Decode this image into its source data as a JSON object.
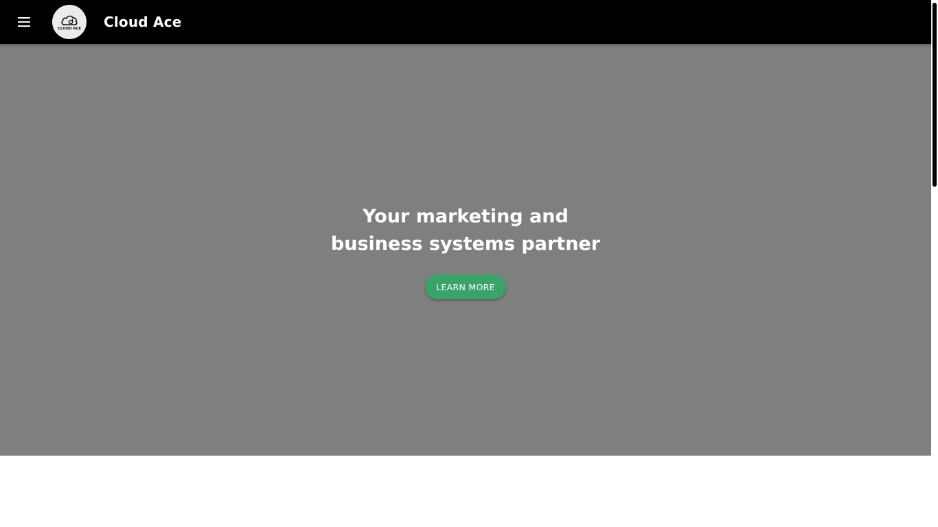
{
  "header": {
    "menu_icon": "hamburger-menu-icon",
    "logo_text": "CLOUD ACE",
    "logo_icon": "cloud-icon",
    "title": "Cloud Ace",
    "background": "#000000"
  },
  "hero": {
    "heading_line1": "Your marketing and",
    "heading_line2": "business systems partner",
    "button_label": "LEARN MORE",
    "button_color": "#3aa36a",
    "background": "#7f7f7f"
  }
}
